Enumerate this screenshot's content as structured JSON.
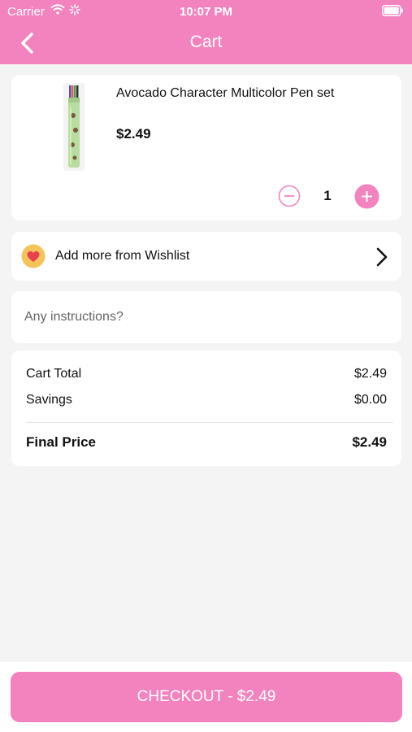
{
  "status_bar": {
    "carrier": "Carrier",
    "time": "10:07 PM"
  },
  "header": {
    "title": "Cart"
  },
  "cart_item": {
    "name": "Avocado Character Multicolor Pen set",
    "price": "$2.49",
    "quantity": "1"
  },
  "wishlist": {
    "label": "Add more from Wishlist"
  },
  "instructions": {
    "placeholder": "Any instructions?",
    "value": ""
  },
  "summary": {
    "cart_total_label": "Cart Total",
    "cart_total_value": "$2.49",
    "savings_label": "Savings",
    "savings_value": "$0.00",
    "final_label": "Final Price",
    "final_value": "$2.49"
  },
  "checkout": {
    "label": "CHECKOUT - $2.49"
  },
  "colors": {
    "brand_pink": "#f283bf",
    "background": "#f4f4f4",
    "heart_red": "#e9424e",
    "heart_circle": "#f6c35b"
  },
  "icons": [
    "back-chevron-icon",
    "wifi-icon",
    "activity-icon",
    "battery-icon",
    "minus-circle-icon",
    "plus-circle-icon",
    "heart-icon",
    "chevron-right-icon"
  ]
}
